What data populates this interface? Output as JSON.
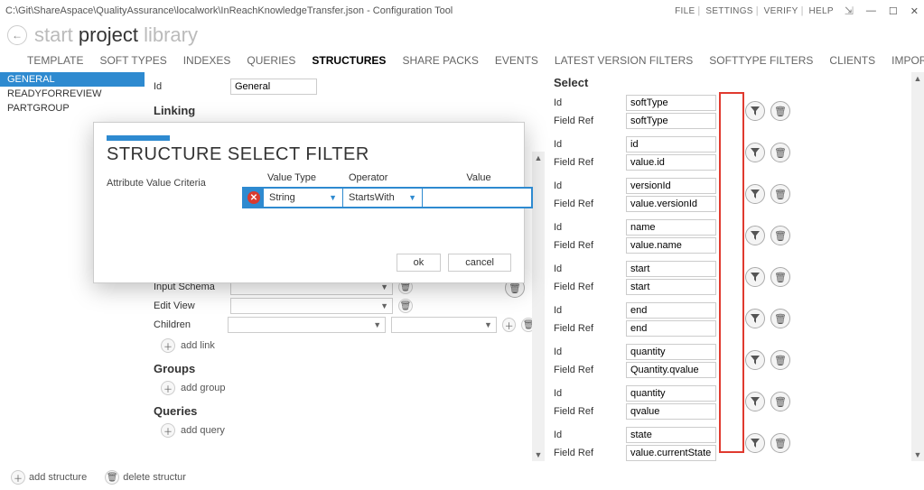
{
  "window": {
    "path": "C:\\Git\\ShareAspace\\QualityAssurance\\localwork\\InReachKnowledgeTransfer.json - Configuration Tool",
    "menu": [
      "FILE",
      "SETTINGS",
      "VERIFY",
      "HELP"
    ]
  },
  "crumbs": {
    "a": "start",
    "b": "project",
    "c": "library"
  },
  "maintabs": [
    "TEMPLATE",
    "SOFT TYPES",
    "INDEXES",
    "QUERIES",
    "STRUCTURES",
    "SHARE PACKS",
    "EVENTS",
    "LATEST VERSION FILTERS",
    "SOFTTYPE FILTERS",
    "CLIENTS",
    "IMPORT ATTRIBUTES"
  ],
  "maintabs_active": "STRUCTURES",
  "sidebar": [
    "GENERAL",
    "READYFORREVIEW",
    "PARTGROUP"
  ],
  "sidebar_selected": "GENERAL",
  "form": {
    "id_label": "Id",
    "id_value": "General",
    "linking": "Linking",
    "input_schema": "Input Schema",
    "edit_view": "Edit View",
    "children": "Children",
    "add_link": "add link",
    "groups": "Groups",
    "add_group": "add group",
    "queries": "Queries",
    "add_query": "add query"
  },
  "right": {
    "header": "Select",
    "id_label": "Id",
    "ref_label": "Field Ref",
    "items": [
      {
        "id": "softType",
        "ref": "softType"
      },
      {
        "id": "id",
        "ref": "value.id"
      },
      {
        "id": "versionId",
        "ref": "value.versionId"
      },
      {
        "id": "name",
        "ref": "value.name"
      },
      {
        "id": "start",
        "ref": "start"
      },
      {
        "id": "end",
        "ref": "end"
      },
      {
        "id": "quantity",
        "ref": "Quantity.qvalue"
      },
      {
        "id": "quantity",
        "ref": "qvalue"
      },
      {
        "id": "state",
        "ref": "value.currentState.id"
      }
    ]
  },
  "modal": {
    "title": "STRUCTURE SELECT FILTER",
    "avc": "Attribute Value Criteria",
    "cols": {
      "value_type": "Value Type",
      "operator": "Operator",
      "value": "Value"
    },
    "row": {
      "value_type": "String",
      "operator": "StartsWith",
      "value": ""
    },
    "ok": "ok",
    "cancel": "cancel"
  },
  "bottom": {
    "add_structure": "add structure",
    "delete_structure": "delete structur"
  }
}
